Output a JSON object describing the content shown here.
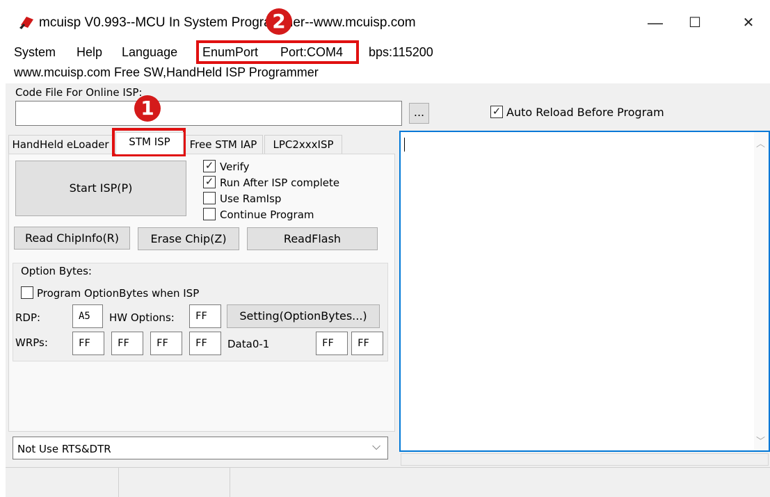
{
  "window": {
    "title": "mcuisp V0.993--MCU In System Programmer--www.mcuisp.com",
    "minimize_glyph": "—",
    "maximize_glyph": "☐",
    "close_glyph": "✕",
    "icon": "red-chip-icon"
  },
  "menu": {
    "system": "System",
    "help": "Help",
    "language": "Language",
    "enum_port": "EnumPort",
    "port": "Port:COM4",
    "bps": "bps:115200"
  },
  "subtitle": "www.mcuisp.com Free SW,HandHeld ISP Programmer",
  "code_file": {
    "label": "Code File For Online ISP:",
    "value": "",
    "browse_label": "...",
    "auto_reload_label": "Auto Reload Before Program",
    "auto_reload_checked": true
  },
  "tabs": [
    {
      "label": "HandHeld eLoader",
      "active": false
    },
    {
      "label": "STM ISP",
      "active": true
    },
    {
      "label": "Free STM IAP",
      "active": false
    },
    {
      "label": "LPC2xxxISP",
      "active": false
    }
  ],
  "stm_isp": {
    "start_button": "Start ISP(P)",
    "verify": {
      "label": "Verify",
      "checked": true
    },
    "run_after": {
      "label": "Run After ISP complete",
      "checked": true
    },
    "use_ramisp": {
      "label": "Use RamIsp",
      "checked": false
    },
    "continue_program": {
      "label": "Continue Program",
      "checked": false
    },
    "read_chipinfo_button": "Read ChipInfo(R)",
    "erase_chip_button": "Erase Chip(Z)",
    "read_flash_button": "ReadFlash"
  },
  "option_bytes": {
    "group_label": "Option Bytes:",
    "program_when_isp": {
      "label": "Program OptionBytes when ISP",
      "checked": false
    },
    "rdp_label": "RDP:",
    "rdp_value": "A5",
    "hw_options_label": "HW Options:",
    "hw_options_value": "FF",
    "setting_button": "Setting(OptionBytes...)",
    "wrps_label": "WRPs:",
    "wrps_values": [
      "FF",
      "FF",
      "FF",
      "FF"
    ],
    "data_label": "Data0-1",
    "data_values": [
      "FF",
      "FF"
    ]
  },
  "rts_dtr": {
    "selected": "Not Use RTS&DTR"
  },
  "annotations": {
    "badge_1": "1",
    "badge_2": "2",
    "highlight_color": "#e01010"
  },
  "check_glyph": "✓",
  "dropdown_glyph": "⌵",
  "scroll_up_glyph": "︿",
  "scroll_down_glyph": "﹀"
}
